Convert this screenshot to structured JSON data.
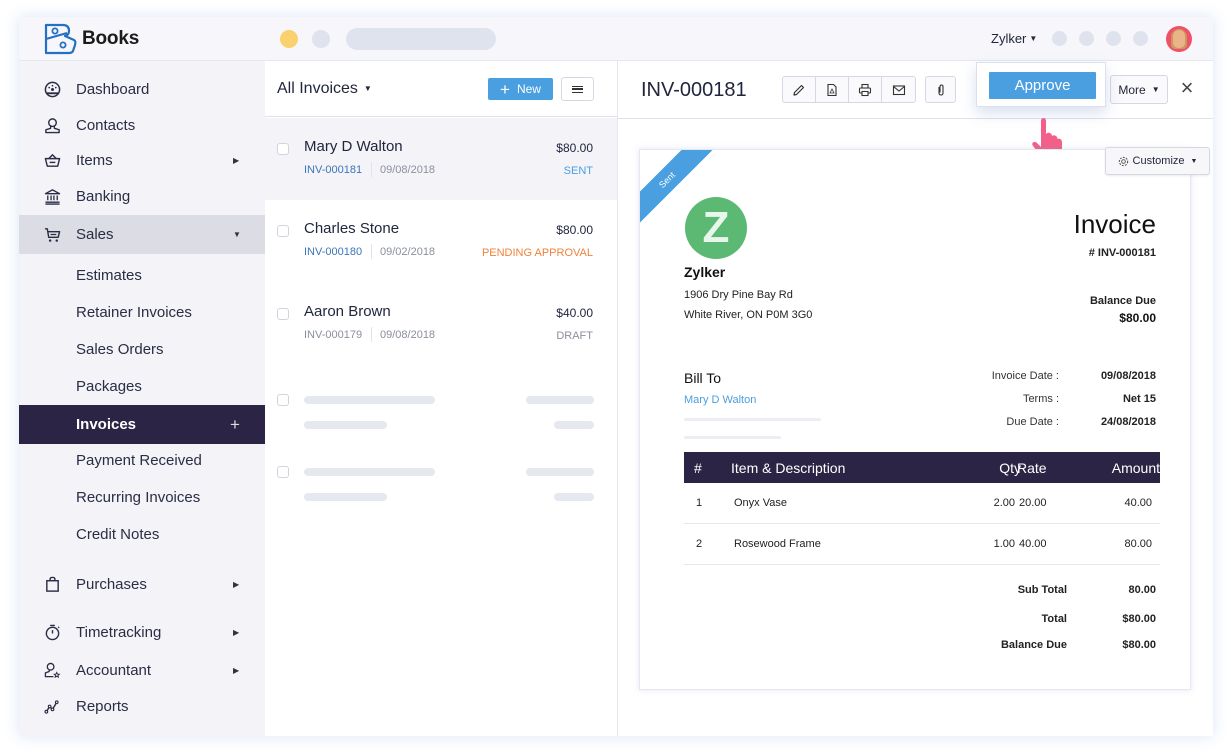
{
  "app": {
    "brand": "Books",
    "org": "Zylker"
  },
  "sidebar": {
    "items": [
      {
        "label": "Dashboard",
        "icon": "dashboard-icon"
      },
      {
        "label": "Contacts",
        "icon": "contacts-icon"
      },
      {
        "label": "Items",
        "icon": "basket-icon"
      },
      {
        "label": "Banking",
        "icon": "bank-icon"
      },
      {
        "label": "Sales",
        "icon": "cart-icon"
      },
      {
        "label": "Estimates"
      },
      {
        "label": "Retainer Invoices"
      },
      {
        "label": "Sales Orders"
      },
      {
        "label": "Packages"
      },
      {
        "label": "Invoices"
      },
      {
        "label": "Payment Received"
      },
      {
        "label": "Recurring Invoices"
      },
      {
        "label": "Credit Notes"
      },
      {
        "label": "Purchases",
        "icon": "bag-icon"
      },
      {
        "label": "Timetracking",
        "icon": "stopwatch-icon"
      },
      {
        "label": "Accountant",
        "icon": "accountant-icon"
      },
      {
        "label": "Reports",
        "icon": "reports-icon"
      }
    ],
    "invoices_add": "+"
  },
  "list": {
    "title": "All Invoices",
    "new_label": "New",
    "rows": [
      {
        "name": "Mary D Walton",
        "amount": "$80.00",
        "invoice_no": "INV-000181",
        "date": "09/08/2018",
        "status": "SENT",
        "status_color": "#4a9fe0"
      },
      {
        "name": "Charles Stone",
        "amount": "$80.00",
        "invoice_no": "INV-000180",
        "date": "09/02/2018",
        "status": "PENDING APPROVAL",
        "status_color": "#f0813a"
      },
      {
        "name": "Aaron Brown",
        "amount": "$40.00",
        "invoice_no": "INV-000179",
        "date": "09/08/2018",
        "status": "DRAFT",
        "status_color": "#8b8f9e"
      }
    ]
  },
  "detail": {
    "title": "INV-000181",
    "approve_label": "Approve",
    "more_label": "More",
    "close": "×",
    "customize_label": "Customize",
    "ribbon": "Sent",
    "logo_letter": "Z",
    "org_name": "Zylker",
    "address_line1": "1906 Dry Pine Bay Rd",
    "address_line2": "White River, ON P0M 3G0",
    "doc_title": "Invoice",
    "doc_number": "# INV-000181",
    "balance_due_label": "Balance Due",
    "balance_due_value": "$80.00",
    "bill_to_label": "Bill To",
    "bill_to_name": "Mary D Walton",
    "meta": [
      {
        "label": "Invoice Date :",
        "value": "09/08/2018"
      },
      {
        "label": "Terms :",
        "value": "Net 15"
      },
      {
        "label": "Due Date :",
        "value": "24/08/2018"
      }
    ],
    "table": {
      "headers": {
        "num": "#",
        "item": "Item & Description",
        "qty": "Qty",
        "rate": "Rate",
        "amount": "Amount"
      },
      "rows": [
        {
          "num": "1",
          "item": "Onyx Vase",
          "qty": "2.00",
          "rate": "20.00",
          "amount": "40.00"
        },
        {
          "num": "2",
          "item": "Rosewood Frame",
          "qty": "1.00",
          "rate": "40.00",
          "amount": "80.00"
        }
      ]
    },
    "totals": [
      {
        "label": "Sub Total",
        "value": "80.00"
      },
      {
        "label": "Total",
        "value": "$80.00"
      },
      {
        "label": "Balance Due",
        "value": "$80.00"
      }
    ]
  }
}
